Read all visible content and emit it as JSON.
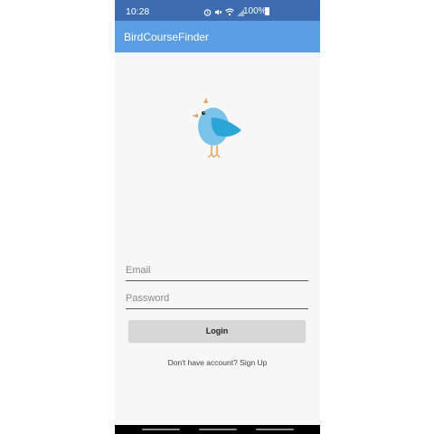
{
  "status_bar": {
    "time": "10:28",
    "battery": "100%",
    "icons": [
      "alarm-icon",
      "mute-icon",
      "wifi-icon",
      "signal-icon",
      "battery-icon"
    ]
  },
  "app_bar": {
    "title": "BirdCourseFinder"
  },
  "logo": {
    "icon": "bird-icon",
    "colors": {
      "body": "#7cc3ec",
      "wing": "#2aa6d6",
      "beak": "#e5a15d",
      "legs": "#e5a15d"
    }
  },
  "form": {
    "email_placeholder": "Email",
    "email_value": "",
    "password_placeholder": "Password",
    "password_value": "",
    "login_label": "Login",
    "signup_text": "Don't have account? Sign Up"
  },
  "colors": {
    "status_bar": "#3d6cb0",
    "app_bar": "#5b9ee3",
    "background": "#f7f7f7",
    "button": "#d7d7d7"
  }
}
